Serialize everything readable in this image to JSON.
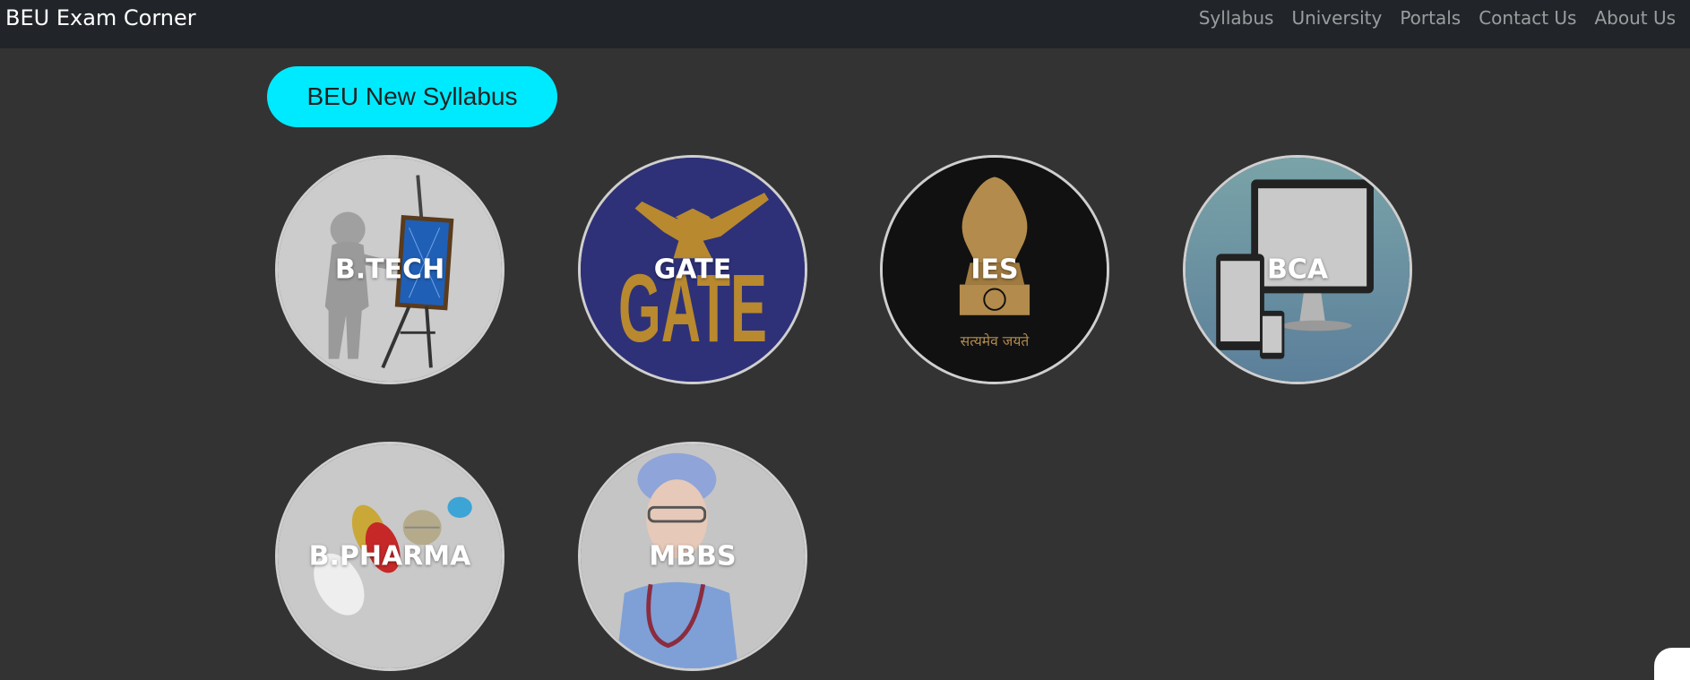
{
  "navbar": {
    "brand": "BEU Exam Corner",
    "links": [
      "Syllabus",
      "University",
      "Portals",
      "Contact Us",
      "About Us"
    ]
  },
  "section": {
    "button_label": "BEU New Syllabus"
  },
  "cards": [
    {
      "label": "B.TECH",
      "image": "engineer-easel-icon"
    },
    {
      "label": "GATE",
      "image": "gate-logo-icon"
    },
    {
      "label": "IES",
      "image": "national-emblem-icon",
      "emblem_text": "सत्यमेव जयते"
    },
    {
      "label": "BCA",
      "image": "computer-devices-icon"
    },
    {
      "label": "B.PHARMA",
      "image": "pills-icon"
    },
    {
      "label": "MBBS",
      "image": "doctor-icon"
    }
  ],
  "colors": {
    "background": "#333333",
    "navbar": "#212529",
    "pill": "#00eaff"
  }
}
